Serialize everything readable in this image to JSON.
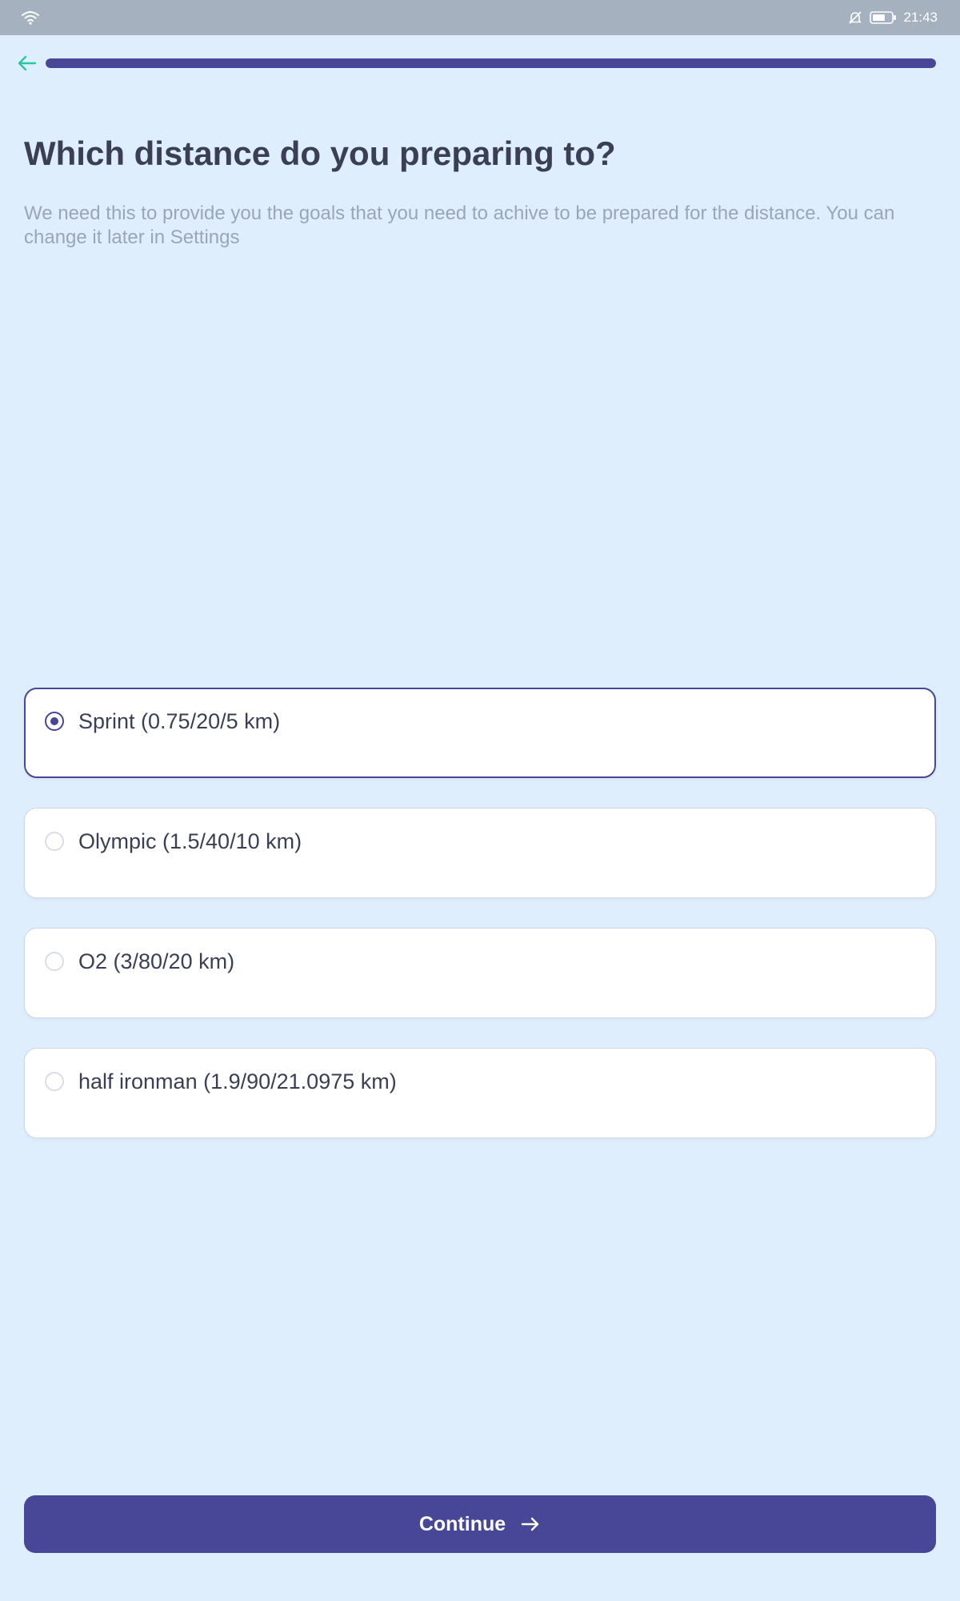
{
  "status_bar": {
    "time": "21:43",
    "icons": [
      "wifi-icon",
      "notifications-off-icon",
      "battery-icon"
    ]
  },
  "header": {
    "back_icon": "arrow-left-icon",
    "progress_fraction": 1.0
  },
  "question": {
    "title": "Which distance do you preparing to?",
    "subtitle": "We need this to provide you the goals that you need to achive to be prepared for the distance. You can change it later in Settings"
  },
  "options": [
    {
      "label": "Sprint (0.75/20/5 km)",
      "selected": true
    },
    {
      "label": "Olympic (1.5/40/10 km)",
      "selected": false
    },
    {
      "label": "O2 (3/80/20 km)",
      "selected": false
    },
    {
      "label": "half ironman (1.9/90/21.0975 km)",
      "selected": false
    }
  ],
  "continue_button": {
    "label": "Continue",
    "icon": "arrow-right-icon"
  },
  "colors": {
    "background": "#dfeefd",
    "accent": "#484696",
    "back_arrow": "#2ec4a0",
    "title": "#3a3f55",
    "subtitle": "#9aa6b6"
  }
}
